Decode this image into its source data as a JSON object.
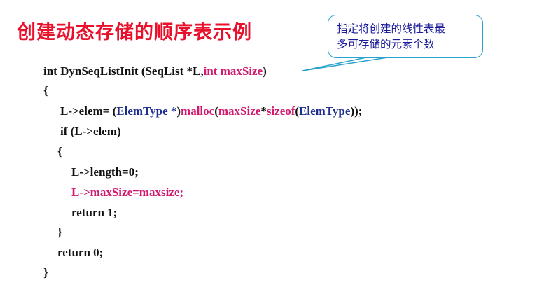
{
  "title": "创建动态存储的顺序表示例",
  "callout": {
    "line1": "指定将创建的线性表最",
    "line2": "多可存储的元素个数"
  },
  "code": {
    "l1_a": "int DynSeqListInit (SeqList *L,",
    "l1_b": "int maxSize",
    "l1_c": ")",
    "l2": "{",
    "l3_a": "L->elem= (",
    "l3_b": "ElemType *",
    "l3_c": ")",
    "l3_d": "malloc",
    "l3_e": "(",
    "l3_f": "maxSize",
    "l3_g": "*",
    "l3_h": "sizeof",
    "l3_i": "(",
    "l3_j": "ElemType",
    "l3_k": "));",
    "l4": "if (L->elem)",
    "l5": "{",
    "l6": "L->length=0;",
    "l7": "L->maxSize=maxsize;",
    "l8": "return 1;",
    "l9": "}",
    "l10": "return 0;",
    "l11": "}"
  },
  "colors": {
    "title": "#e8102b",
    "keyword": "#d01a6e",
    "type": "#1e2e8e",
    "callout_border": "#2aa3cc",
    "callout_text": "#1d1d9c"
  }
}
